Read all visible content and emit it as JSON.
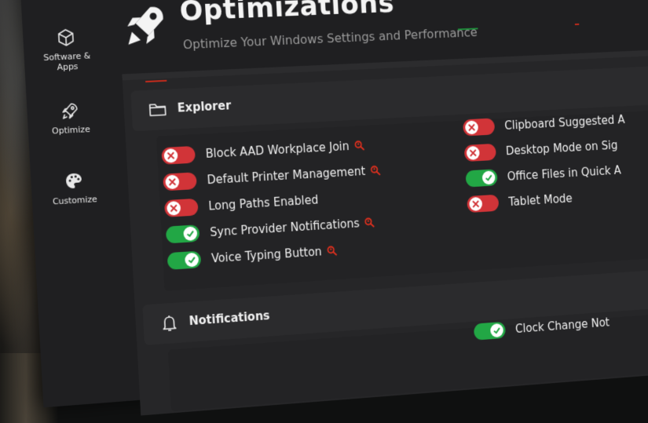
{
  "sidebar": {
    "items": [
      {
        "label_line1": "Software &",
        "label_line2": "Apps",
        "icon": "cube-icon"
      },
      {
        "label_line1": "Optimize",
        "icon": "rocket-icon"
      },
      {
        "label_line1": "Customize",
        "icon": "palette-icon"
      }
    ]
  },
  "header": {
    "title": "Optimizations",
    "subtitle": "Optimize Your Windows Settings and Performance",
    "icon": "rocket-icon"
  },
  "sections": {
    "explorer": {
      "title": "Explorer",
      "icon": "folder-icon",
      "left": [
        {
          "label": "Block AAD Workplace Join",
          "state": "off",
          "warning": true
        },
        {
          "label": "Default Printer Management",
          "state": "off",
          "warning": true
        },
        {
          "label": "Long Paths Enabled",
          "state": "off",
          "warning": false
        },
        {
          "label": "Sync Provider Notifications",
          "state": "on",
          "warning": true
        },
        {
          "label": "Voice Typing Button",
          "state": "on",
          "warning": true
        }
      ],
      "right": [
        {
          "label": "Clipboard Suggested A",
          "state": "off"
        },
        {
          "label": "Desktop Mode on Sig",
          "state": "off"
        },
        {
          "label": "Office Files in Quick A",
          "state": "on"
        },
        {
          "label": "Tablet Mode",
          "state": "off"
        }
      ]
    },
    "notifications": {
      "title": "Notifications",
      "icon": "bell-icon",
      "right": [
        {
          "label": "Clock Change Not",
          "state": "on"
        }
      ]
    }
  },
  "colors": {
    "toggle_off": "#d13438",
    "toggle_on": "#22a745",
    "warning": "#e0301e"
  }
}
